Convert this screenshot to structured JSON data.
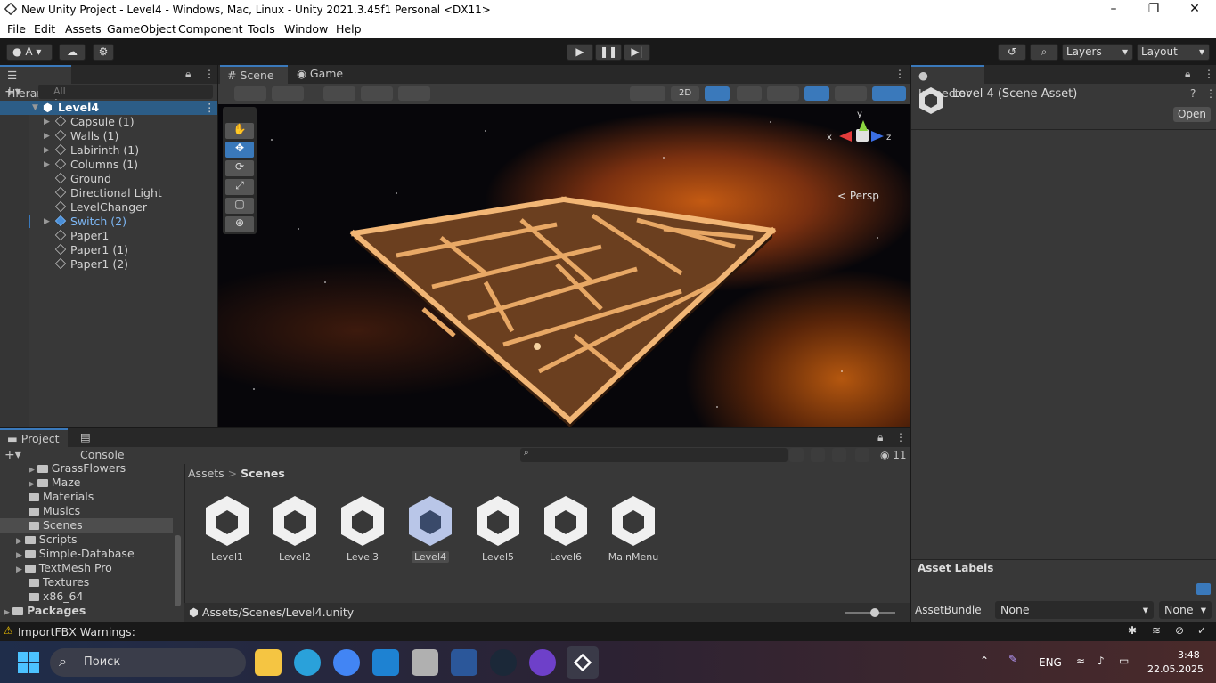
{
  "window": {
    "title": "New Unity Project - Level4 - Windows, Mac, Linux - Unity 2021.3.45f1 Personal <DX11>"
  },
  "menu": [
    "File",
    "Edit",
    "Assets",
    "GameObject",
    "Component",
    "Tools",
    "Window",
    "Help"
  ],
  "toolbar": {
    "account": "A",
    "layers": "Layers",
    "layout": "Layout"
  },
  "hierarchy": {
    "tab": "Hierarchy",
    "search_placeholder": "All",
    "scene": "Level4",
    "items": [
      "Capsule (1)",
      "Walls (1)",
      "Labirinth (1)",
      "Columns (1)",
      "Ground",
      "Directional Light",
      "LevelChanger",
      "Switch (2)",
      "Paper1",
      "Paper1 (1)",
      "Paper1 (2)"
    ]
  },
  "scene_view": {
    "tabs": [
      "Scene",
      "Game"
    ],
    "mode_2d": "2D",
    "persp": "< Persp",
    "gizmo": {
      "y": "y",
      "x": "x",
      "z": "z"
    }
  },
  "inspector": {
    "tab": "Inspector",
    "title": "Level 4 (Scene Asset)",
    "open": "Open",
    "asset_labels": "Asset Labels",
    "assetbundle_label": "AssetBundle",
    "assetbundle_value": "None",
    "variant_value": "None"
  },
  "project": {
    "tabs": [
      "Project",
      "Console"
    ],
    "tree": [
      "GrassFlowers",
      "Maze",
      "Materials",
      "Musics",
      "Scenes",
      "Scripts",
      "Simple-Database",
      "TextMesh Pro",
      "Textures",
      "x86_64",
      "Packages"
    ],
    "breadcrumb": [
      "Assets",
      "Scenes"
    ],
    "assets": [
      "Level1",
      "Level2",
      "Level3",
      "Level4",
      "Level5",
      "Level6",
      "MainMenu"
    ],
    "selected_path": "Assets/Scenes/Level4.unity",
    "hidden_count": "11"
  },
  "status": {
    "warning": "ImportFBX Warnings:"
  },
  "taskbar": {
    "search": "Поиск",
    "lang": "ENG",
    "time": "3:48",
    "date": "22.05.2025"
  },
  "colors": {
    "accent": "#3a79bb",
    "selection": "#2c5d87",
    "switch_text": "#7db7f5"
  }
}
